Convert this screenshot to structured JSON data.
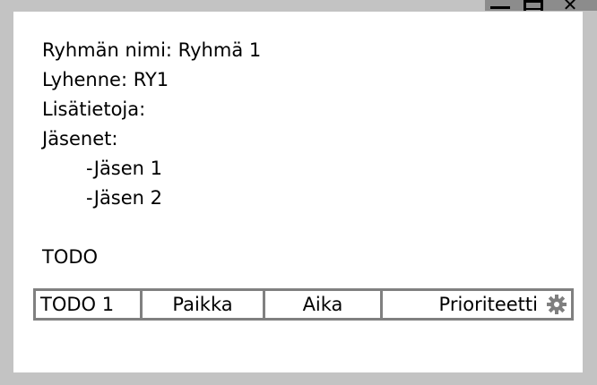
{
  "window": {
    "controls": [
      "minimize-icon",
      "maximize-icon",
      "close-icon"
    ],
    "close_glyph": "✕"
  },
  "group": {
    "name_line": "Ryhmän nimi: Ryhmä 1",
    "abbr_line": "Lyhenne: RY1",
    "info_line": "Lisätietoja:",
    "members_label": "Jäsenet:",
    "members": [
      "-Jäsen 1",
      "-Jäsen 2"
    ]
  },
  "todo": {
    "heading": "TODO",
    "row": {
      "title": "TODO 1",
      "place": "Paikka",
      "time": "Aika",
      "priority": "Prioriteetti",
      "settings_icon": "gear-icon"
    }
  },
  "colors": {
    "background": "#c3c3c3",
    "titlebar": "#8c8c8c",
    "window": "#ffffff",
    "row_border": "#808080",
    "gear": "#7f7f7f"
  }
}
